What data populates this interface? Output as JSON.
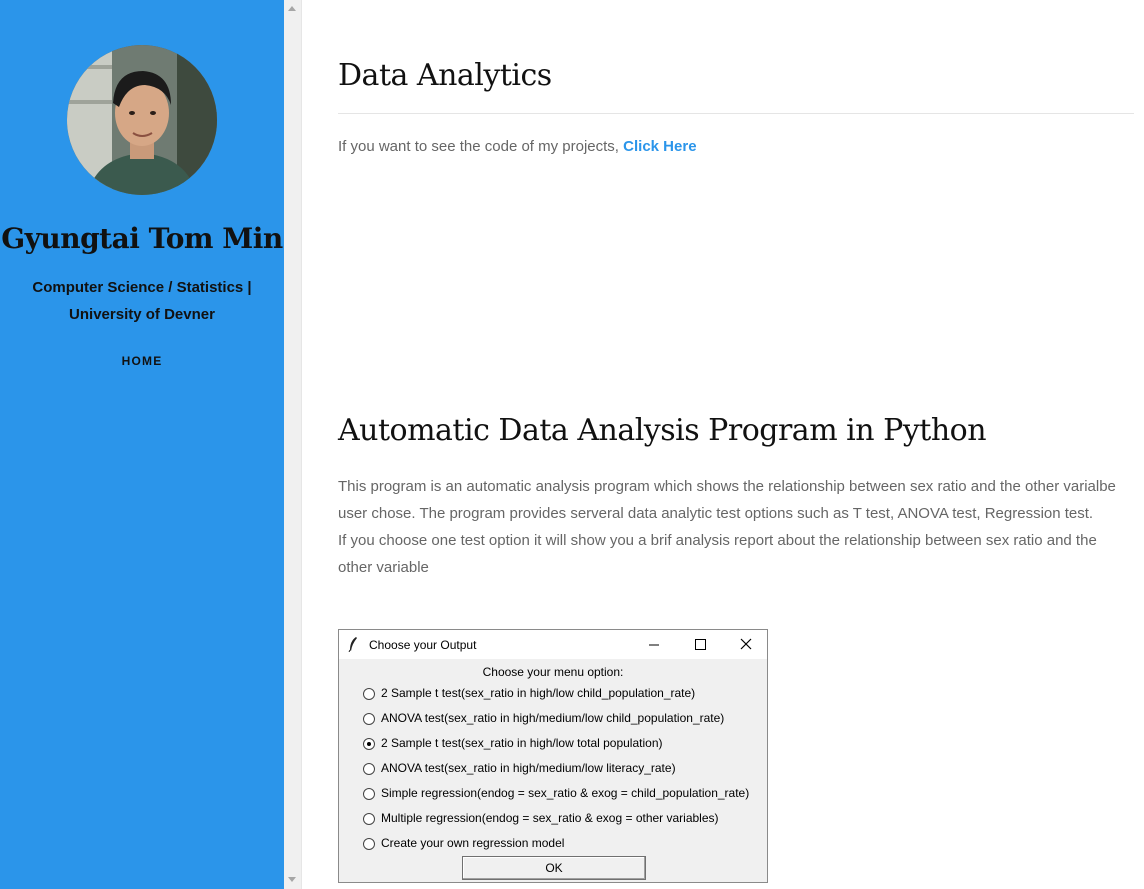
{
  "sidebar": {
    "name": "Gyungtai Tom Min",
    "subtitle_line1": "Computer Science / Statistics |",
    "subtitle_line2": "University of Devner",
    "nav": [
      "HOME"
    ],
    "color": "#2b95ea"
  },
  "main": {
    "title": "Data Analytics",
    "intro_text": "If you want to see the code of my projects,",
    "intro_link": "Click Here",
    "section_title": "Automatic Data Analysis Program in Python",
    "paragraph1": "This program is an automatic analysis program which shows the relationship between sex ratio and the other varialbe user chose. The program provides serveral data analytic test options such as T test, ANOVA test, Regression test.",
    "paragraph2": "If you choose one test option it will show you a brif analysis report about the relationship between sex ratio and the other variable",
    "link_color": "#2b95ea"
  },
  "dialog": {
    "title": "Choose your Output",
    "heading": "Choose your menu option:",
    "options": [
      {
        "label": "2 Sample t test(sex_ratio in high/low child_population_rate)",
        "checked": false
      },
      {
        "label": "ANOVA test(sex_ratio in high/medium/low child_population_rate)",
        "checked": false
      },
      {
        "label": "2 Sample t test(sex_ratio in high/low total population)",
        "checked": true
      },
      {
        "label": "ANOVA test(sex_ratio in high/medium/low literacy_rate)",
        "checked": false
      },
      {
        "label": "Simple regression(endog = sex_ratio & exog = child_population_rate)",
        "checked": false
      },
      {
        "label": "Multiple regression(endog = sex_ratio & exog = other variables)",
        "checked": false
      },
      {
        "label": "Create your own regression model",
        "checked": false
      }
    ],
    "ok_label": "OK"
  }
}
